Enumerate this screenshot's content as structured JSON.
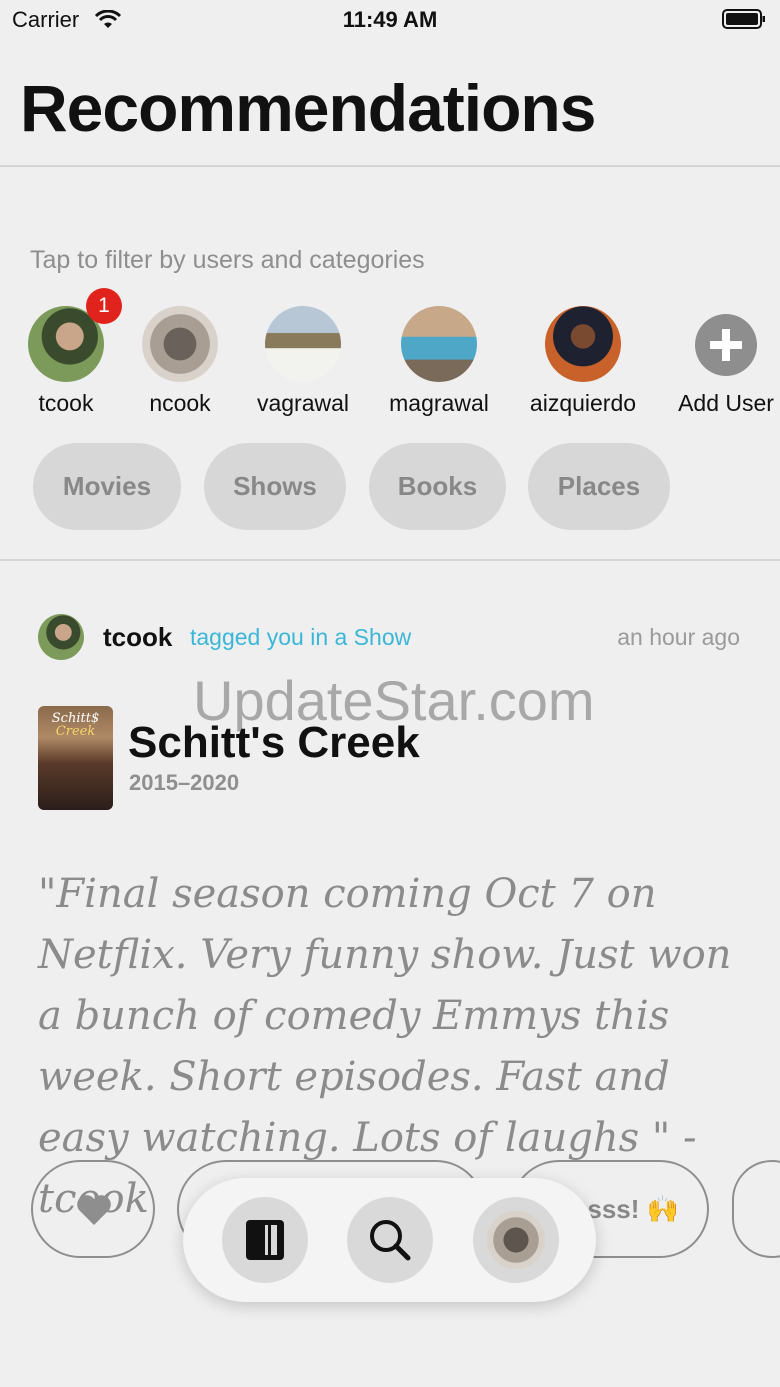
{
  "status_bar": {
    "carrier": "Carrier",
    "time": "11:49 AM"
  },
  "title": "Recommendations",
  "filter": {
    "hint": "Tap to filter by users and categories",
    "users": [
      {
        "name": "tcook",
        "badge": "1"
      },
      {
        "name": "ncook"
      },
      {
        "name": "vagrawal"
      },
      {
        "name": "magrawal"
      },
      {
        "name": "aizquierdo"
      }
    ],
    "add_user_label": "Add User",
    "categories": [
      "Movies",
      "Shows",
      "Books",
      "Places"
    ]
  },
  "feed_item": {
    "user": "tcook",
    "action": "tagged you in a Show",
    "time": "an hour ago",
    "watermark": "UpdateStar.com",
    "poster_text_line1": "Schitt$",
    "poster_text_line2": "Creek",
    "show_title": "Schitt's Creek",
    "years": "2015–2020",
    "quote": "\"Final season coming Oct 7 on Netflix. Very funny show. Just won a bunch of comedy Emmys this week. Short episodes. Fast and easy watching. Lots of laughs  \" -tcook",
    "reaction_partial": "sss! 🙌"
  },
  "icons": {
    "wifi": "wifi-icon",
    "battery": "battery-icon",
    "add": "plus-icon",
    "like": "heart-icon",
    "library": "book-icon",
    "search": "search-icon",
    "profile": "profile-avatar"
  }
}
